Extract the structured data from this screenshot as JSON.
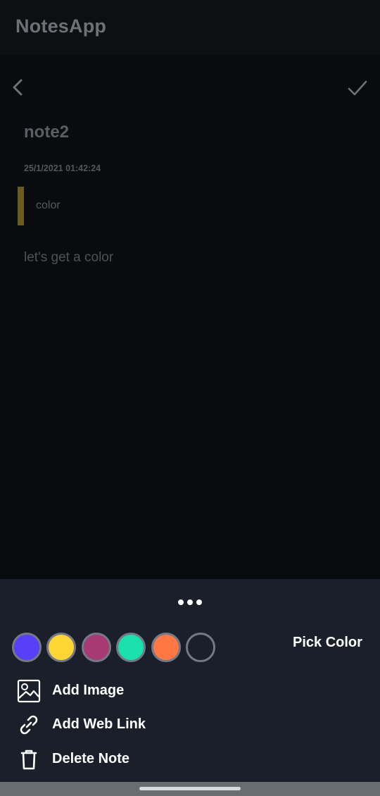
{
  "app": {
    "title": "NotesApp"
  },
  "toolbar": {
    "back_icon": "chevron-left-icon",
    "done_icon": "check-icon"
  },
  "note": {
    "title": "note2",
    "date": "25/1/2021 01:42:24",
    "subtitle": "color",
    "body": "let's get a color",
    "indicator_color": "#6e5c1c"
  },
  "sheet": {
    "handle_icon": "more-dots-icon",
    "pick_color_label": "Pick Color",
    "colors": [
      {
        "name": "purple",
        "hex": "#5a3ff9"
      },
      {
        "name": "yellow",
        "hex": "#fdd635"
      },
      {
        "name": "magenta",
        "hex": "#a83a73"
      },
      {
        "name": "teal",
        "hex": "#19e0ad"
      },
      {
        "name": "orange",
        "hex": "#ff7844"
      },
      {
        "name": "default",
        "hex": "#1b1f2a"
      }
    ],
    "menu": [
      {
        "label": "Add Image",
        "icon": "image-icon"
      },
      {
        "label": "Add Web Link",
        "icon": "link-icon"
      },
      {
        "label": "Delete Note",
        "icon": "trash-icon"
      }
    ]
  }
}
